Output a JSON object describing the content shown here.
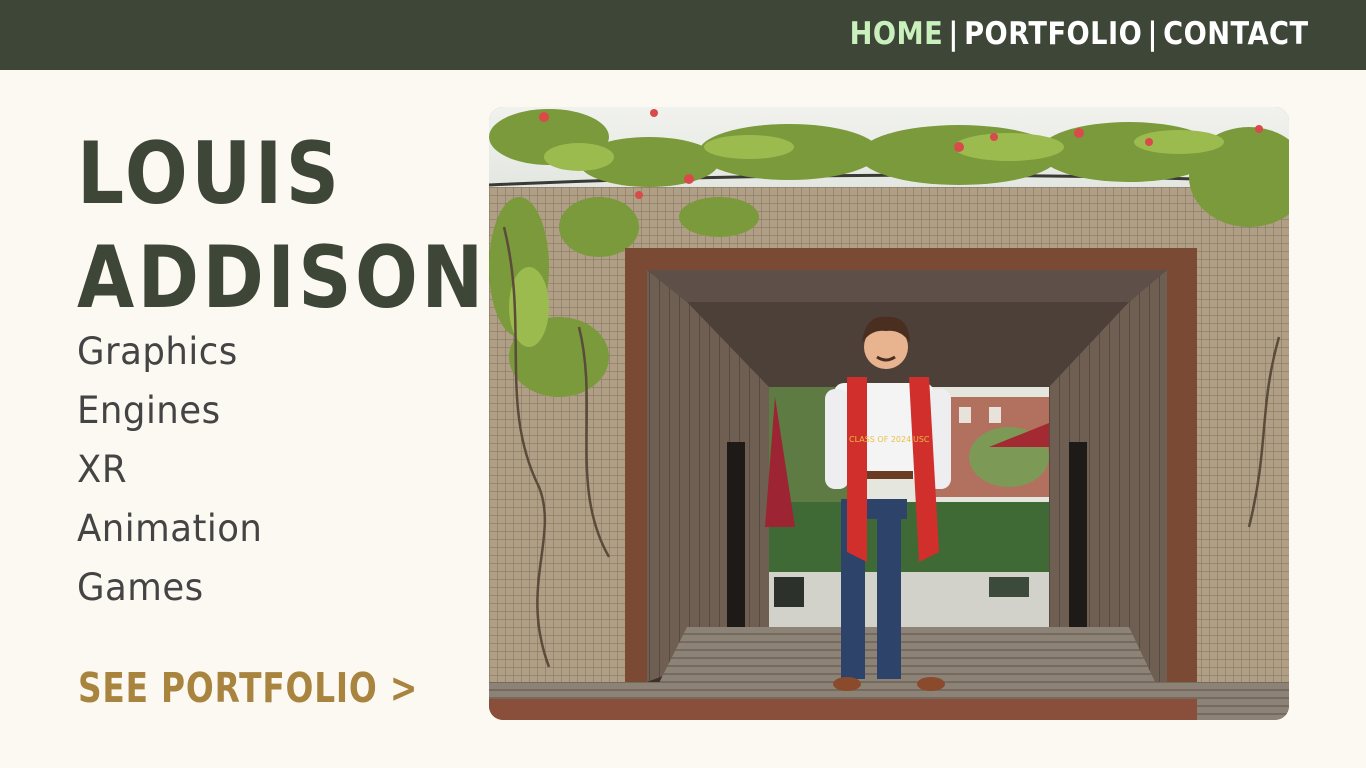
{
  "nav": {
    "items": [
      {
        "label": "HOME",
        "active": true
      },
      {
        "label": "PORTFOLIO",
        "active": false
      },
      {
        "label": "CONTACT",
        "active": false
      }
    ],
    "separator": "|"
  },
  "hero": {
    "first_name": "LOUIS",
    "last_name": "ADDISON",
    "skills": [
      "Graphics",
      "Engines",
      "XR",
      "Animation",
      "Games"
    ],
    "cta_label": "SEE PORTFOLIO >"
  },
  "photo": {
    "stole_text_left": "CLASS OF 2024",
    "stole_text_right": "USC"
  },
  "colors": {
    "topbar": "#3d4637",
    "nav_active": "#c9f0bd",
    "name": "#3d4637",
    "cta": "#a8843f",
    "background": "#fcf8f2"
  }
}
